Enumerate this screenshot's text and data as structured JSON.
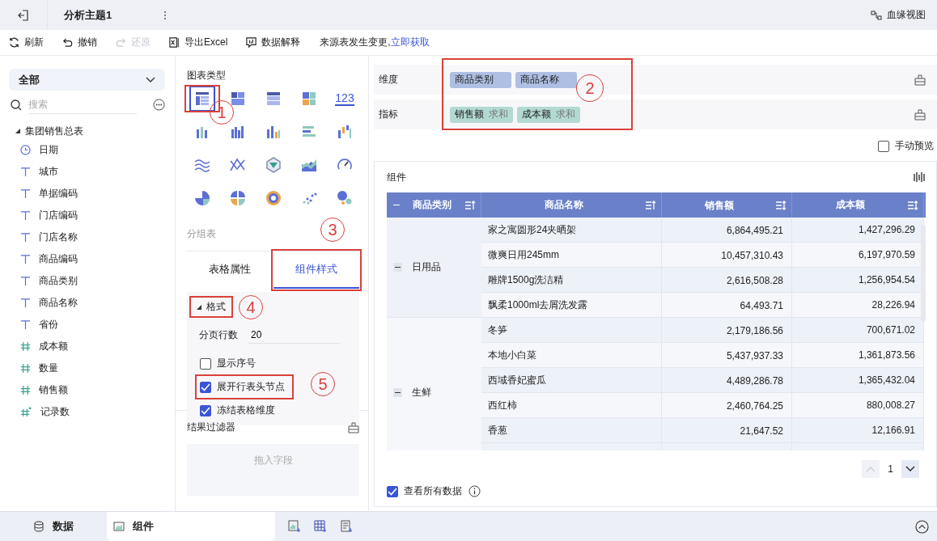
{
  "top_bar": {
    "title": "分析主题1",
    "lineage": "血缘视图"
  },
  "toolbar": [
    {
      "kind": "refresh",
      "label": "刷新",
      "disabled": false
    },
    {
      "kind": "undo",
      "label": "撤销",
      "disabled": false
    },
    {
      "kind": "redo",
      "label": "还原",
      "disabled": true
    },
    {
      "kind": "excel",
      "label": "导出Excel",
      "disabled": false
    },
    {
      "kind": "explain",
      "label": "数据解释",
      "disabled": false
    }
  ],
  "notice": {
    "text": "来源表发生变更,",
    "link": "立即获取"
  },
  "data_panel": {
    "scope": "全部",
    "search_placeholder": "搜索",
    "tree": [
      {
        "label": "集团销售总表",
        "expanded": true,
        "children": [
          {
            "kind": "date",
            "label": "日期"
          },
          {
            "kind": "text",
            "label": "城市"
          },
          {
            "kind": "text",
            "label": "单据编码"
          },
          {
            "kind": "text",
            "label": "门店编码"
          },
          {
            "kind": "text",
            "label": "门店名称"
          },
          {
            "kind": "text",
            "label": "商品编码"
          },
          {
            "kind": "text",
            "label": "商品类别"
          },
          {
            "kind": "text",
            "label": "商品名称"
          },
          {
            "kind": "text",
            "label": "省份"
          },
          {
            "kind": "number",
            "label": "成本额"
          },
          {
            "kind": "number",
            "label": "数量"
          },
          {
            "kind": "number",
            "label": "销售额"
          },
          {
            "kind": "count",
            "label": "记录数"
          }
        ]
      }
    ]
  },
  "chart_panel": {
    "title": "图表类型",
    "chart_types": [
      {
        "selected": true,
        "callout": "1"
      },
      {
        "selected": false
      },
      {
        "selected": false
      },
      {
        "selected": false
      },
      {
        "selected": false,
        "glyph": "123"
      },
      {
        "selected": false
      },
      {
        "selected": false
      },
      {
        "selected": false
      },
      {
        "selected": false
      },
      {
        "selected": false
      },
      {
        "selected": false
      },
      {
        "selected": false
      },
      {
        "selected": false
      },
      {
        "selected": false
      },
      {
        "selected": false
      },
      {
        "selected": false
      },
      {
        "selected": false
      },
      {
        "selected": false
      },
      {
        "selected": false
      },
      {
        "selected": false
      }
    ],
    "chart_name": "分组表",
    "tabs": [
      {
        "label": "表格属性",
        "selected": false
      },
      {
        "label": "组件样式",
        "selected": true,
        "callout": "3"
      }
    ],
    "section": {
      "label": "格式",
      "expanded": true,
      "callout": "4"
    },
    "page_rows": {
      "label": "分页行数",
      "value": "20"
    },
    "options": [
      {
        "label": "显示序号",
        "checked": false
      },
      {
        "label": "展开行表头节点",
        "checked": true,
        "callout": "5"
      },
      {
        "label": "冻结表格维度",
        "checked": true
      }
    ],
    "filter": {
      "title": "结果过滤器",
      "placeholder": "拖入字段"
    }
  },
  "fields": {
    "callout": "2",
    "dimensions": {
      "label": "维度",
      "items": [
        {
          "name": "商品类别"
        },
        {
          "name": "商品名称"
        }
      ]
    },
    "metrics": {
      "label": "指标",
      "items": [
        {
          "name": "销售额",
          "agg": "求和"
        },
        {
          "name": "成本额",
          "agg": "求和"
        }
      ]
    }
  },
  "manual_preview": {
    "label": "手动预览",
    "checked": false
  },
  "widget": {
    "title": "组件",
    "columns": [
      {
        "label": "商品类别",
        "sorted": true
      },
      {
        "label": "商品名称",
        "sorted": true
      },
      {
        "label": "销售额",
        "sorted": false
      },
      {
        "label": "成本额",
        "sorted": false
      }
    ],
    "groups": [
      {
        "category": "日用品",
        "expanded": true,
        "rows": [
          {
            "name": "家之寓圆形24夹晒架",
            "sales": "6,864,495.21",
            "cost": "1,427,296.29"
          },
          {
            "name": "微爽日用245mm",
            "sales": "10,457,310.43",
            "cost": "6,197,970.59"
          },
          {
            "name": "雕牌1500g洗洁精",
            "sales": "2,616,508.28",
            "cost": "1,256,954.54"
          },
          {
            "name": "飘柔1000ml去屑洗发露",
            "sales": "64,493.71",
            "cost": "28,226.94"
          }
        ]
      },
      {
        "category": "生鲜",
        "expanded": true,
        "rows": [
          {
            "name": "冬笋",
            "sales": "2,179,186.56",
            "cost": "700,671.02"
          },
          {
            "name": "本地小白菜",
            "sales": "5,437,937.33",
            "cost": "1,361,873.56"
          },
          {
            "name": "西域香妃蜜瓜",
            "sales": "4,489,286.78",
            "cost": "1,365,432.04"
          },
          {
            "name": "西红柿",
            "sales": "2,460,764.25",
            "cost": "880,008.27"
          },
          {
            "name": "香葱",
            "sales": "21,647.52",
            "cost": "12,166.91"
          }
        ]
      }
    ],
    "page": "1",
    "view_all": {
      "label": "查看所有数据",
      "checked": true
    }
  },
  "bottom_tabs": [
    {
      "kind": "data",
      "label": "数据",
      "selected": false
    },
    {
      "kind": "widget",
      "label": "组件",
      "selected": true
    }
  ]
}
